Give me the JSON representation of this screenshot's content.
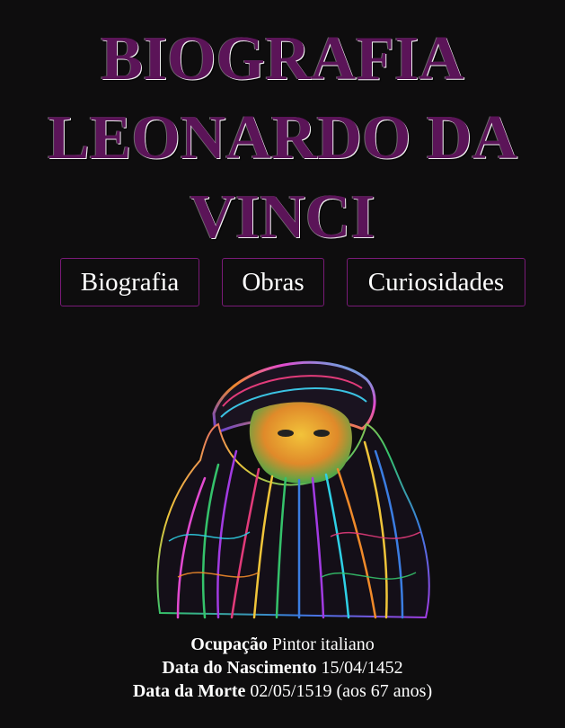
{
  "header": {
    "title_lines": [
      "BIOGRAFIA",
      "LEONARDO DA",
      "VINCI"
    ],
    "title_color": "#5b1458"
  },
  "nav": {
    "items": [
      {
        "label": "Biografia"
      },
      {
        "label": "Obras"
      },
      {
        "label": "Curiosidades"
      }
    ],
    "border_color": "#7a1a78"
  },
  "portrait": {
    "icon": "leonardo-da-vinci-portrait"
  },
  "info": {
    "occupation_label": "Ocupação",
    "occupation_value": "Pintor italiano",
    "birth_label": "Data do Nascimento",
    "birth_value": "15/04/1452",
    "death_label": "Data da Morte",
    "death_value": "02/05/1519 (aos 67 anos)"
  }
}
